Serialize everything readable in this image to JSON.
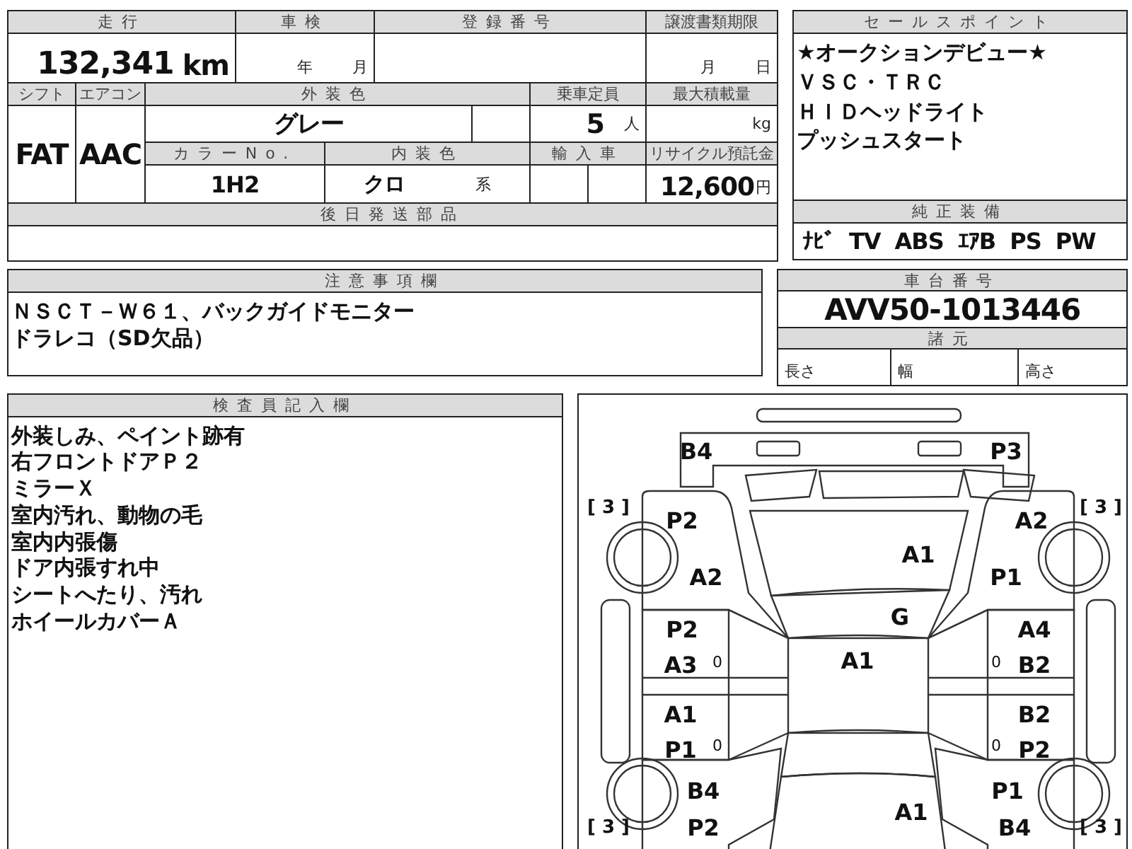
{
  "vehicle_info": {
    "mileage": {
      "label": "走行",
      "value": "132,341",
      "unit": "km"
    },
    "inspection": {
      "label": "車検",
      "year_unit": "年",
      "month_unit": "月"
    },
    "registration_number": {
      "label": "登録番号"
    },
    "transfer_deadline": {
      "label": "譲渡書類期限",
      "month_unit": "月",
      "day_unit": "日"
    },
    "shift": {
      "label": "シフト",
      "value": "FAT"
    },
    "air_conditioner": {
      "label": "エアコン",
      "value": "AAC"
    },
    "exterior_color": {
      "label": "外装色",
      "value": "グレー"
    },
    "capacity": {
      "label": "乗車定員",
      "value": "5",
      "unit": "人"
    },
    "max_load": {
      "label": "最大積載量",
      "unit": "kg"
    },
    "color_number": {
      "label": "カラーNo.",
      "value": "1H2"
    },
    "interior_color": {
      "label": "内装色",
      "value": "クロ",
      "unit": "系"
    },
    "imported": {
      "label": "輸入車"
    },
    "recycle_fee": {
      "label": "リサイクル預託金",
      "value": "12,600",
      "unit": "円"
    },
    "later_parts": {
      "label": "後日発送部品"
    }
  },
  "sale_points": {
    "label": "セールスポイント",
    "items": [
      "★オークションデビュー★",
      "ＶＳＣ・ＴＲＣ",
      "ＨＩＤヘッドライト",
      "プッシュスタート"
    ]
  },
  "standard_equipment": {
    "label": "純正装備",
    "items": [
      "ﾅﾋﾞ",
      "TV",
      "ABS",
      "ｴｱB",
      "PS",
      "PW"
    ]
  },
  "notes": {
    "label": "注意事項欄",
    "lines": [
      "ＮＳＣＴ－Ｗ６１、バックガイドモニター",
      "ドラレコ（SD欠品）"
    ]
  },
  "chassis": {
    "label": "車台番号",
    "value": "AVV50-1013446"
  },
  "specs": {
    "label": "諸元",
    "fields": [
      "長さ",
      "幅",
      "高さ"
    ]
  },
  "inspector_notes": {
    "label": "検査員記入欄",
    "lines": [
      "外装しみ、ペイント跡有",
      "右フロントドアＰ２",
      "ミラーＸ",
      "室内汚れ、動物の毛",
      "室内内張傷",
      "ドア内張すれ中",
      "シートへたり、汚れ",
      "ホイールカバーＡ"
    ]
  },
  "damage_diagram": {
    "marks": [
      {
        "text": "B4"
      },
      {
        "text": "P3"
      },
      {
        "text": "[ 3 ]"
      },
      {
        "text": "P2"
      },
      {
        "text": "[ 3 ]"
      },
      {
        "text": "A2"
      },
      {
        "text": "A1"
      },
      {
        "text": "A2"
      },
      {
        "text": "P1"
      },
      {
        "text": "G"
      },
      {
        "text": "P2"
      },
      {
        "text": "A4"
      },
      {
        "text": "A3"
      },
      {
        "text": "0"
      },
      {
        "text": "A1"
      },
      {
        "text": "0"
      },
      {
        "text": "B2"
      },
      {
        "text": "A1"
      },
      {
        "text": "B2"
      },
      {
        "text": "P1"
      },
      {
        "text": "0"
      },
      {
        "text": "0"
      },
      {
        "text": "P2"
      },
      {
        "text": "B4"
      },
      {
        "text": "P1"
      },
      {
        "text": "A1"
      },
      {
        "text": "[ 3 ]"
      },
      {
        "text": "P2"
      },
      {
        "text": "B4"
      },
      {
        "text": "[ 3 ]"
      }
    ]
  }
}
